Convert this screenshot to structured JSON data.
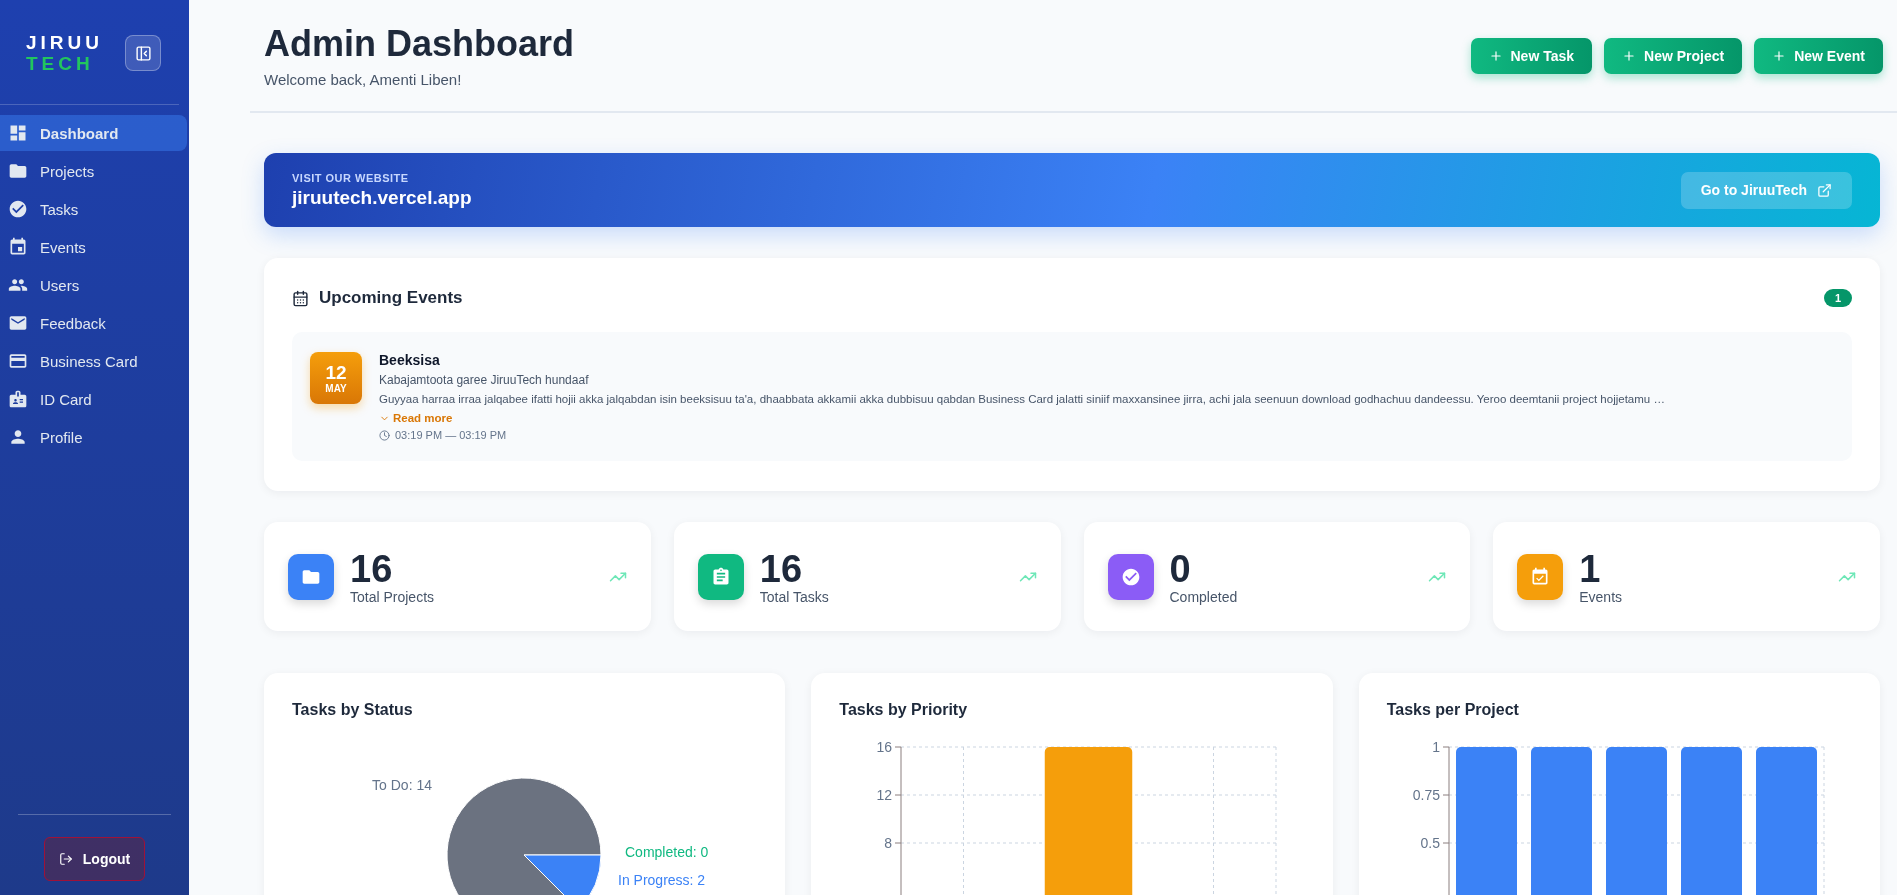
{
  "sidebar": {
    "logo_top": "JIRUU",
    "logo_bottom": "TECH",
    "items": [
      {
        "label": "Dashboard",
        "selected": true
      },
      {
        "label": "Projects",
        "selected": false
      },
      {
        "label": "Tasks",
        "selected": false
      },
      {
        "label": "Events",
        "selected": false
      },
      {
        "label": "Users",
        "selected": false
      },
      {
        "label": "Feedback",
        "selected": false
      },
      {
        "label": "Business Card",
        "selected": false
      },
      {
        "label": "ID Card",
        "selected": false
      },
      {
        "label": "Profile",
        "selected": false
      }
    ],
    "logout": "Logout"
  },
  "header": {
    "title": "Admin Dashboard",
    "subtitle": "Welcome back, Amenti Liben!",
    "buttons": [
      "New Task",
      "New Project",
      "New Event"
    ]
  },
  "banner": {
    "eyebrow": "VISIT OUR WEBSITE",
    "url": "jiruutech.vercel.app",
    "button": "Go to JiruuTech"
  },
  "events": {
    "title": "Upcoming Events",
    "count": "1",
    "items": [
      {
        "day": "12",
        "month": "MAY",
        "name": "Beeksisa",
        "subtitle": "Kabajamtoota garee JiruuTech hundaaf",
        "description": "Guyyaa harraa irraa jalqabee ifatti hojii akka jalqabdan isin beeksisuu ta'a, dhaabbata akkamii akka dubbisuu qabdan Business Card jalatti siniif maxxansinee jirra, achi jala seenuun download godhachuu dandeessu. Yeroo deemtanii project hojjetamu …",
        "read_more": "Read more",
        "time": "03:19 PM — 03:19 PM"
      }
    ]
  },
  "stats": [
    {
      "value": "16",
      "label": "Total Projects",
      "kind": "folder",
      "color": "#3b82f6"
    },
    {
      "value": "16",
      "label": "Total Tasks",
      "kind": "clipboard",
      "color": "#10b981"
    },
    {
      "value": "0",
      "label": "Completed",
      "kind": "check",
      "color": "#8b5cf6"
    },
    {
      "value": "1",
      "label": "Events",
      "kind": "calendar",
      "color": "#f59e0b"
    }
  ],
  "charts": [
    {
      "title": "Tasks by Status",
      "chart_data": {
        "type": "pie",
        "values": [
          14,
          2,
          0
        ],
        "colors": [
          "#6b7280",
          "#3b82f6",
          "#10b981"
        ],
        "value_labels": [
          "To Do: 14",
          "In Progress: 2",
          "Completed: 0"
        ]
      }
    },
    {
      "title": "Tasks by Priority",
      "chart_data": {
        "type": "bar",
        "series": [
          {
            "color": "#f59e0b",
            "values": [
              0,
              16,
              0
            ]
          }
        ],
        "ylim": [
          0,
          16
        ],
        "yticks": [
          8,
          12,
          16
        ],
        "grid": true
      }
    },
    {
      "title": "Tasks per Project",
      "chart_data": {
        "type": "bar",
        "series": [
          {
            "color": "#3b82f6",
            "values": [
              1,
              1,
              1,
              1,
              1
            ]
          }
        ],
        "ylim": [
          0,
          1
        ],
        "yticks": [
          0.5,
          0.75,
          1
        ],
        "grid": true
      }
    }
  ]
}
